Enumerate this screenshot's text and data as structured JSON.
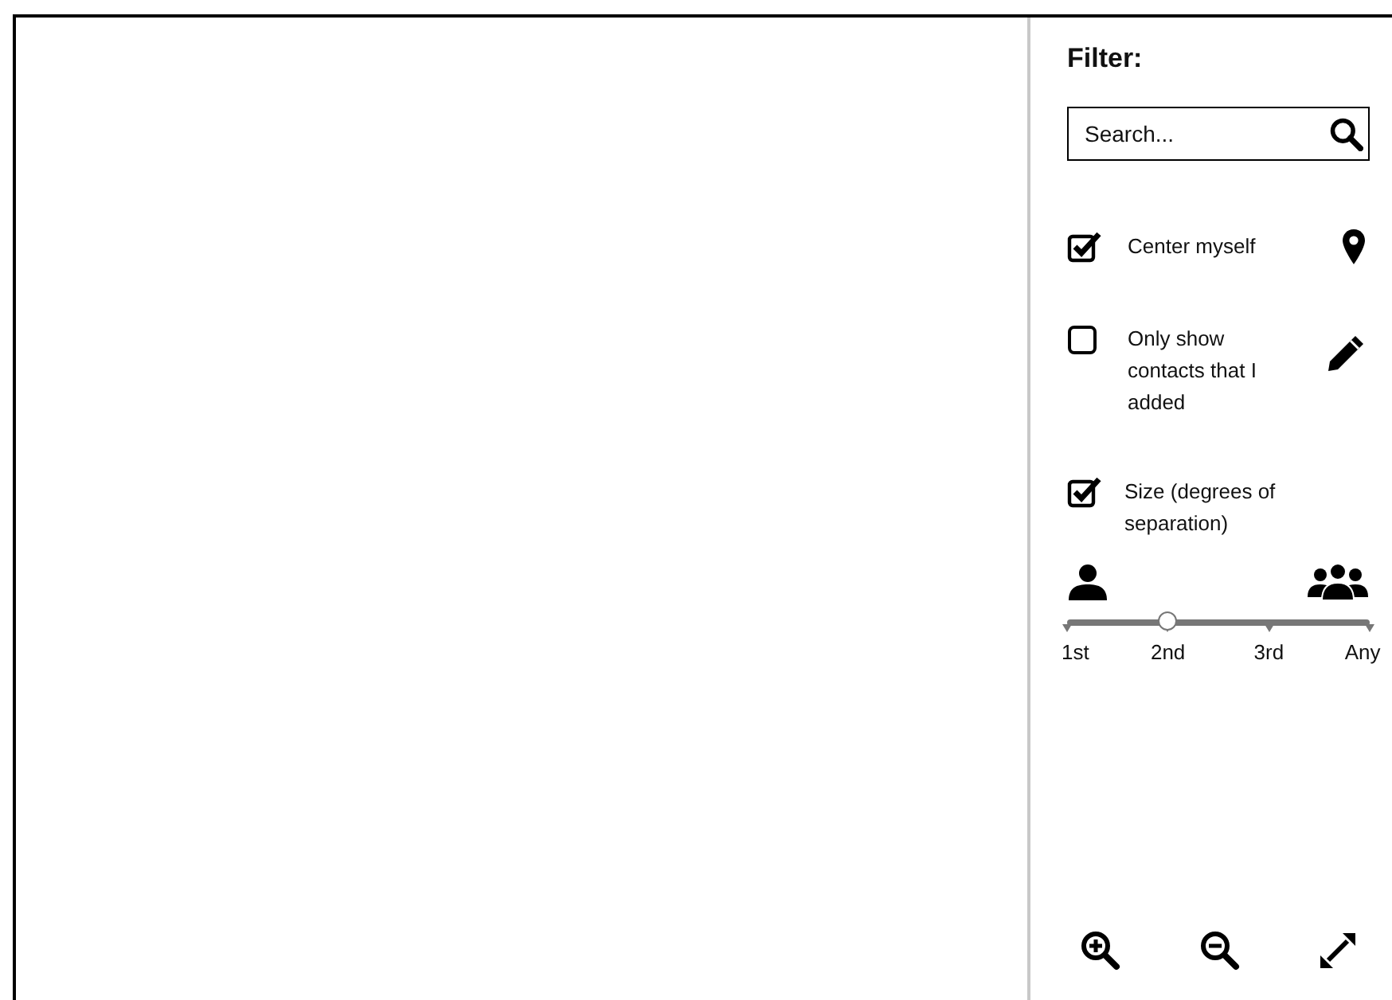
{
  "filter": {
    "title": "Filter:",
    "search": {
      "placeholder": "Search..."
    },
    "options": [
      {
        "label": "Center myself",
        "checked": true
      },
      {
        "label": "Only show contacts that I added",
        "checked": false
      },
      {
        "label": "Size (degrees of separation)",
        "checked": true
      }
    ]
  },
  "size_slider": {
    "level": 0.333,
    "stops": [
      "1st",
      "2nd",
      "3rd",
      "Any"
    ]
  }
}
